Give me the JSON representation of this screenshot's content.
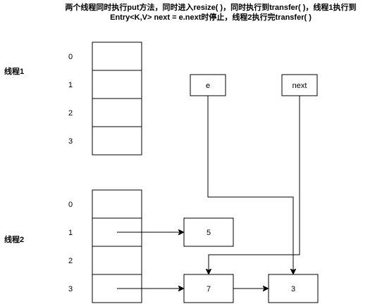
{
  "title": {
    "line1": "两个线程同时执行put方法，同时进入resize( )，同时执行到transfer( )，线程1执行到",
    "line2": "Entry<K,V> next = e.next时停止，线程2执行完transfer( )"
  },
  "thread1": {
    "label": "线程1",
    "indices": [
      "0",
      "1",
      "2",
      "3"
    ],
    "pointer_e": "e",
    "pointer_next": "next"
  },
  "thread2": {
    "label": "线程2",
    "indices": [
      "0",
      "1",
      "2",
      "3"
    ],
    "node_5": "5",
    "node_7": "7",
    "node_3": "3"
  }
}
